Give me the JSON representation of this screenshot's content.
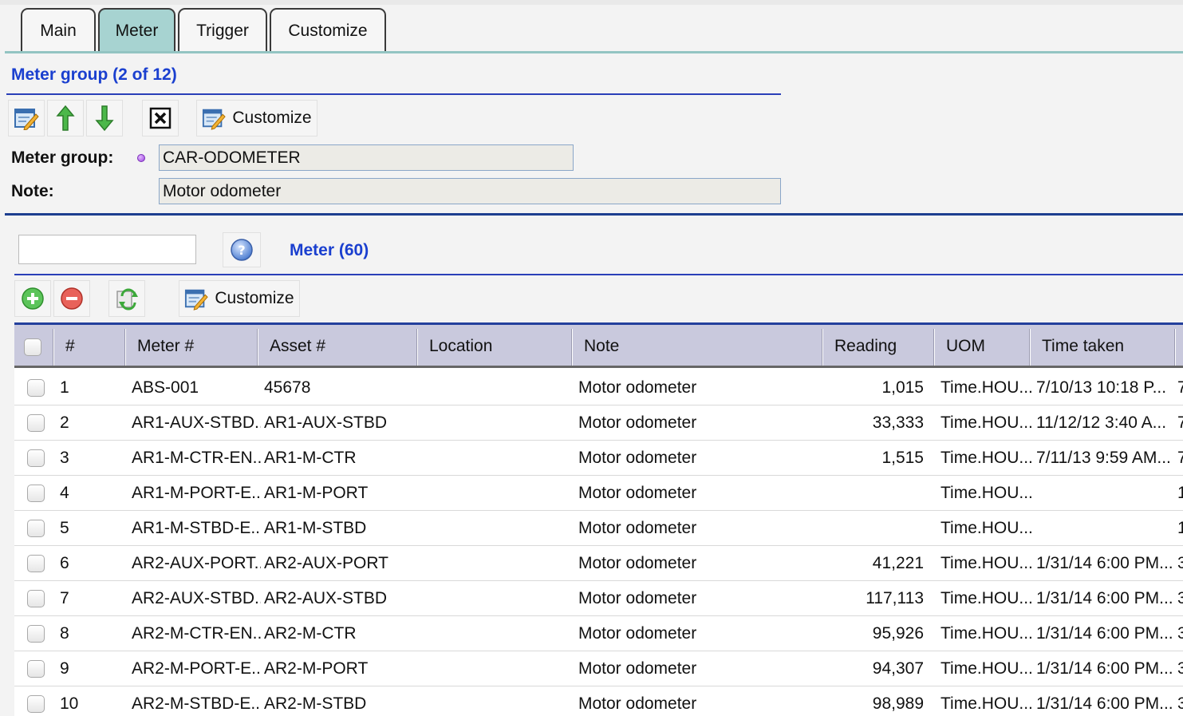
{
  "tabs": [
    {
      "label": "Main"
    },
    {
      "label": "Meter"
    },
    {
      "label": "Trigger"
    },
    {
      "label": "Customize"
    }
  ],
  "meter_group_section": {
    "title": "Meter group (2 of 12)",
    "toolbar": {
      "customize_label": "Customize"
    },
    "fields": {
      "meter_group_label": "Meter group:",
      "meter_group_value": "CAR-ODOMETER",
      "note_label": "Note:",
      "note_value": "Motor odometer"
    }
  },
  "meter_section": {
    "title": "Meter (60)",
    "search_value": "",
    "toolbar": {
      "customize_label": "Customize"
    },
    "columns": [
      "#",
      "Meter #",
      "Asset #",
      "Location",
      "Note",
      "Reading",
      "UOM",
      "Time taken"
    ],
    "rows": [
      {
        "n": "1",
        "meter": "ABS-001",
        "asset": "45678",
        "location": "",
        "note": "Motor odometer",
        "reading": "1,015",
        "uom": "Time.HOU...",
        "time": "7/10/13 10:18 P...",
        "extra": "7"
      },
      {
        "n": "2",
        "meter": "AR1-AUX-STBD...",
        "asset": "AR1-AUX-STBD",
        "location": "",
        "note": "Motor odometer",
        "reading": "33,333",
        "uom": "Time.HOU...",
        "time": "11/12/12 3:40 A...",
        "extra": "7"
      },
      {
        "n": "3",
        "meter": "AR1-M-CTR-EN...",
        "asset": "AR1-M-CTR",
        "location": "",
        "note": "Motor odometer",
        "reading": "1,515",
        "uom": "Time.HOU...",
        "time": "7/11/13 9:59 AM...",
        "extra": "7"
      },
      {
        "n": "4",
        "meter": "AR1-M-PORT-E...",
        "asset": "AR1-M-PORT",
        "location": "",
        "note": "Motor odometer",
        "reading": "",
        "uom": "Time.HOU...",
        "time": "",
        "extra": "1"
      },
      {
        "n": "5",
        "meter": "AR1-M-STBD-E...",
        "asset": "AR1-M-STBD",
        "location": "",
        "note": "Motor odometer",
        "reading": "",
        "uom": "Time.HOU...",
        "time": "",
        "extra": "1"
      },
      {
        "n": "6",
        "meter": "AR2-AUX-PORT...",
        "asset": "AR2-AUX-PORT",
        "location": "",
        "note": "Motor odometer",
        "reading": "41,221",
        "uom": "Time.HOU...",
        "time": "1/31/14 6:00 PM...",
        "extra": "3"
      },
      {
        "n": "7",
        "meter": "AR2-AUX-STBD...",
        "asset": "AR2-AUX-STBD",
        "location": "",
        "note": "Motor odometer",
        "reading": "117,113",
        "uom": "Time.HOU...",
        "time": "1/31/14 6:00 PM...",
        "extra": "3"
      },
      {
        "n": "8",
        "meter": "AR2-M-CTR-EN...",
        "asset": "AR2-M-CTR",
        "location": "",
        "note": "Motor odometer",
        "reading": "95,926",
        "uom": "Time.HOU...",
        "time": "1/31/14 6:00 PM...",
        "extra": "3"
      },
      {
        "n": "9",
        "meter": "AR2-M-PORT-E...",
        "asset": "AR2-M-PORT",
        "location": "",
        "note": "Motor odometer",
        "reading": "94,307",
        "uom": "Time.HOU...",
        "time": "1/31/14 6:00 PM...",
        "extra": "3"
      },
      {
        "n": "10",
        "meter": "AR2-M-STBD-E...",
        "asset": "AR2-M-STBD",
        "location": "",
        "note": "Motor odometer",
        "reading": "98,989",
        "uom": "Time.HOU...",
        "time": "1/31/14 6:00 PM...",
        "extra": "3"
      }
    ]
  }
}
